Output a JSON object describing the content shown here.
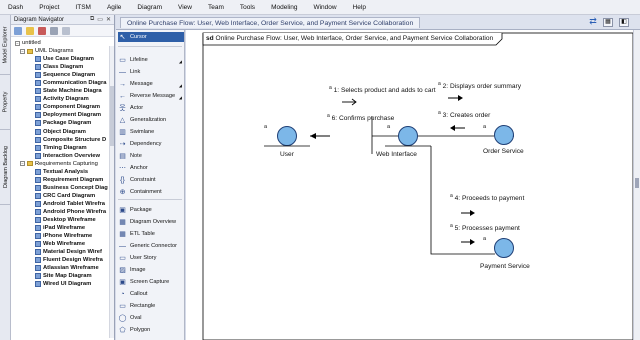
{
  "menu": [
    "Dash",
    "Project",
    "ITSM",
    "Agile",
    "Diagram",
    "View",
    "Team",
    "Tools",
    "Modeling",
    "Window",
    "Help"
  ],
  "left_tabs": [
    "Model Explorer",
    "Property",
    "Diagram Backlog"
  ],
  "navigator": {
    "title": "Diagram Navigator",
    "root": "untitled",
    "items": [
      {
        "level": 2,
        "kind": "folder",
        "label": "UML Diagrams",
        "expanded": true
      },
      {
        "level": 3,
        "label": "Use Case Diagram"
      },
      {
        "level": 3,
        "label": "Class Diagram"
      },
      {
        "level": 3,
        "label": "Sequence Diagram"
      },
      {
        "level": 3,
        "label": "Communication Diagra"
      },
      {
        "level": 3,
        "label": "State Machine Diagra"
      },
      {
        "level": 3,
        "label": "Activity Diagram"
      },
      {
        "level": 3,
        "label": "Component Diagram"
      },
      {
        "level": 3,
        "label": "Deployment Diagram"
      },
      {
        "level": 3,
        "label": "Package Diagram"
      },
      {
        "level": 3,
        "label": "Object Diagram"
      },
      {
        "level": 3,
        "label": "Composite Structure D"
      },
      {
        "level": 3,
        "label": "Timing Diagram"
      },
      {
        "level": 3,
        "label": "Interaction Overview"
      },
      {
        "level": 2,
        "kind": "folder",
        "label": "Requirements Capturing",
        "expanded": true
      },
      {
        "level": 3,
        "label": "Textual Analysis"
      },
      {
        "level": 3,
        "label": "Requirement Diagram"
      },
      {
        "level": 3,
        "label": "Business Concept Diag"
      },
      {
        "level": 3,
        "label": "CRC Card Diagram"
      },
      {
        "level": 3,
        "label": "Android Tablet Wirefra"
      },
      {
        "level": 3,
        "label": "Android Phone Wirefra"
      },
      {
        "level": 3,
        "label": "Desktop Wireframe"
      },
      {
        "level": 3,
        "label": "iPad Wireframe"
      },
      {
        "level": 3,
        "label": "iPhone Wireframe"
      },
      {
        "level": 3,
        "label": "Web Wireframe"
      },
      {
        "level": 3,
        "label": "Material Design Wiref"
      },
      {
        "level": 3,
        "label": "Fluent Design Wirefra"
      },
      {
        "level": 3,
        "label": "Atlassian Wireframe"
      },
      {
        "level": 3,
        "label": "Site Map Diagram"
      },
      {
        "level": 3,
        "label": "Wired UI Diagram"
      }
    ]
  },
  "palette": [
    {
      "icon": "cursor-icon",
      "glyph": "↖",
      "label": "Cursor",
      "selected": true
    },
    {
      "icon": "lifeline-icon",
      "glyph": "▭",
      "label": "Lifeline",
      "more": true
    },
    {
      "icon": "link-icon",
      "glyph": "—",
      "label": "Link"
    },
    {
      "icon": "message-icon",
      "glyph": "→",
      "label": "Message",
      "more": true
    },
    {
      "icon": "reverse-message-icon",
      "glyph": "←",
      "label": "Reverse Message",
      "more": true
    },
    {
      "icon": "actor-icon",
      "glyph": "웃",
      "label": "Actor"
    },
    {
      "icon": "generalization-icon",
      "glyph": "△",
      "label": "Generalization"
    },
    {
      "icon": "swimlane-icon",
      "glyph": "▥",
      "label": "Swimlane"
    },
    {
      "icon": "dependency-icon",
      "glyph": "⇢",
      "label": "Dependency"
    },
    {
      "icon": "note-icon",
      "glyph": "▤",
      "label": "Note"
    },
    {
      "icon": "anchor-icon",
      "glyph": "⋯",
      "label": "Anchor"
    },
    {
      "icon": "constraint-icon",
      "glyph": "{}",
      "label": "Constraint"
    },
    {
      "icon": "containment-icon",
      "glyph": "⊕",
      "label": "Containment"
    },
    {
      "icon": "package-icon",
      "glyph": "▣",
      "label": "Package"
    },
    {
      "icon": "diagram-overview-icon",
      "glyph": "▦",
      "label": "Diagram Overview"
    },
    {
      "icon": "etl-table-icon",
      "glyph": "▦",
      "label": "ETL Table"
    },
    {
      "icon": "generic-connector-icon",
      "glyph": "—",
      "label": "Generic Connector"
    },
    {
      "icon": "user-story-icon",
      "glyph": "▭",
      "label": "User Story"
    },
    {
      "icon": "image-icon",
      "glyph": "▨",
      "label": "Image"
    },
    {
      "icon": "screen-capture-icon",
      "glyph": "▣",
      "label": "Screen Capture"
    },
    {
      "icon": "callout-icon",
      "glyph": "◔",
      "label": "Callout"
    },
    {
      "icon": "rectangle-icon",
      "glyph": "▭",
      "label": "Rectangle"
    },
    {
      "icon": "oval-icon",
      "glyph": "◯",
      "label": "Oval"
    },
    {
      "icon": "polygon-icon",
      "glyph": "⬠",
      "label": "Polygon"
    }
  ],
  "diagram": {
    "tab_title": "Online Purchase Flow: User, Web Interface, Order Service, and Payment Service Collaboration",
    "frame_keyword": "sd",
    "frame_title": "Online Purchase Flow: User, Web Interface, Order Service, and Payment Service Collaboration",
    "objects": [
      "User",
      "Web Interface",
      "Order Service",
      "Payment Service"
    ],
    "object_prefix": "a",
    "messages": [
      {
        "seq": "1",
        "text": "Selects product and adds to cart"
      },
      {
        "seq": "2",
        "text": "Displays order summary"
      },
      {
        "seq": "3",
        "text": "Creates order"
      },
      {
        "seq": "4",
        "text": "Proceeds to payment"
      },
      {
        "seq": "5",
        "text": "Processes payment"
      },
      {
        "seq": "6",
        "text": "Confirms purchase"
      }
    ]
  },
  "colors": {
    "object_fill": "#7cb7e8",
    "object_stroke": "#1f3f75",
    "selected_palette": "#2e5fa8"
  }
}
